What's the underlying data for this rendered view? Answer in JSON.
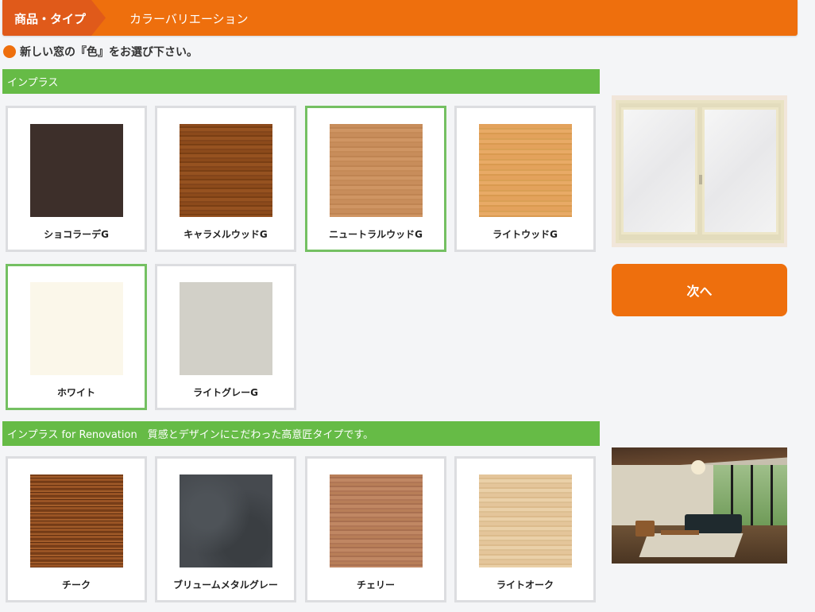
{
  "header": {
    "breadcrumb_first": "商品・タイプ",
    "breadcrumb_second": "カラーバリエーション"
  },
  "lead_text": "新しい窓の『色』をお選び下さい。",
  "sections": [
    {
      "title": "インプラス",
      "swatches": [
        {
          "label": "ショコラーデG",
          "color": "#3d2f2a",
          "selected": false
        },
        {
          "label": "キャラメルウッドG",
          "color": "#8c4a1b",
          "selected": false
        },
        {
          "label": "ニュートラルウッドG",
          "color": "#c88d5b",
          "selected": true
        },
        {
          "label": "ライトウッドG",
          "color": "#e3a25c",
          "selected": false
        },
        {
          "label": "ホワイト",
          "color": "#fbf7ea",
          "selected": true
        },
        {
          "label": "ライトグレーG",
          "color": "#d2d0c8",
          "selected": false
        }
      ]
    },
    {
      "title": "インプラス for Renovation　質感とデザインにこだわった高意匠タイプです。",
      "swatches": [
        {
          "label": "チーク",
          "color": "#7a3f18",
          "selected": false
        },
        {
          "label": "ブリュームメタルグレー",
          "color": "#464a4f",
          "selected": false
        },
        {
          "label": "チェリー",
          "color": "#b87e58",
          "selected": false
        },
        {
          "label": "ライトオーク",
          "color": "#e4c59a",
          "selected": false
        }
      ]
    }
  ],
  "next_button_label": "次へ",
  "colors": {
    "accent_orange": "#ee6f0d",
    "section_green": "#66bb46",
    "selected_border": "#74c062"
  }
}
